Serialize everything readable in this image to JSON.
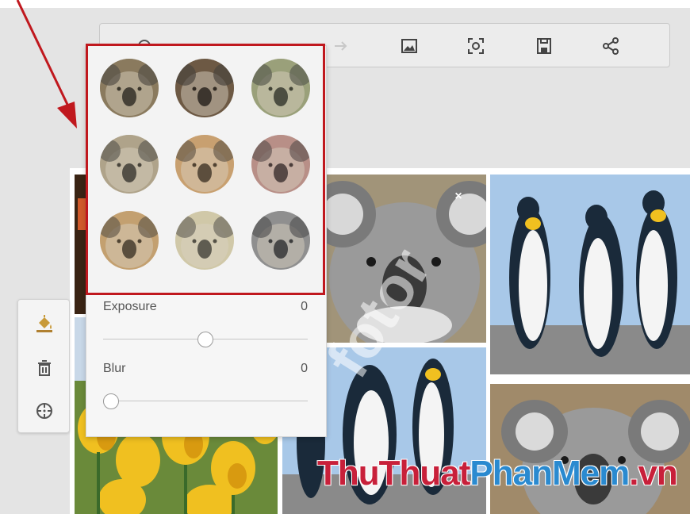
{
  "adjust": {
    "exposure": {
      "label": "Exposure",
      "value": "0",
      "level": 0.5
    },
    "blur": {
      "label": "Blur",
      "value": "0",
      "level": 0.0
    }
  },
  "watermark": {
    "part1": "ThuThuat",
    "part2": "PhanMem",
    "part3": ".vn",
    "fotor": "fotor"
  },
  "toolbar": {
    "icons": [
      "undo-icon",
      "redo-icon",
      "image-icon",
      "screenshot-icon",
      "save-icon",
      "share-icon"
    ]
  },
  "dock": {
    "icons": [
      "paint-bucket-icon",
      "trash-icon",
      "crosshair-icon"
    ]
  },
  "filters": {
    "count": 9,
    "tints": [
      "#8a7a5e",
      "#6d5a44",
      "#9aa07a",
      "#b0a48a",
      "#c8a070",
      "#b89088",
      "#c4a070",
      "#d0c8a8",
      "#909090"
    ]
  },
  "colors": {
    "accent_red": "#c0181e",
    "wm_blue": "#2a8ad0",
    "wm_red": "#c8203a"
  },
  "close_glyph": "×"
}
